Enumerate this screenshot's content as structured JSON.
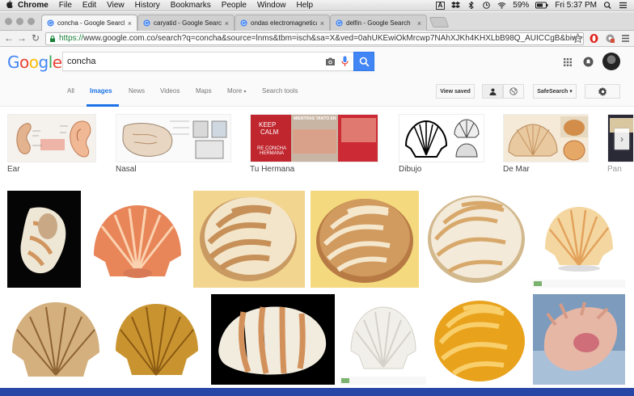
{
  "menubar": {
    "items": [
      "Chrome",
      "File",
      "Edit",
      "View",
      "History",
      "Bookmarks",
      "People",
      "Window",
      "Help"
    ],
    "battery": "59%",
    "clock": "Fri 5:37 PM",
    "input_indicator": "A"
  },
  "tabs": [
    {
      "label": "concha - Google Search",
      "active": true
    },
    {
      "label": "caryatid - Google Search",
      "active": false
    },
    {
      "label": "ondas electromagneticas",
      "active": false
    },
    {
      "label": "delfin - Google Search",
      "active": false
    }
  ],
  "toolbar": {
    "url_scheme": "https://",
    "url_rest": "www.google.com.co/search?q=concha&source=lnms&tbm=isch&sa=X&ved=0ahUKEwiOkMrcwp7NAhXJKh4KHXLbB98Q_AUICCgB&biw=1280&bih..."
  },
  "search": {
    "query": "concha",
    "logo_letters": [
      {
        "ch": "G",
        "color": "#4285F4"
      },
      {
        "ch": "o",
        "color": "#EA4335"
      },
      {
        "ch": "o",
        "color": "#FBBC05"
      },
      {
        "ch": "g",
        "color": "#4285F4"
      },
      {
        "ch": "l",
        "color": "#34A853"
      },
      {
        "ch": "e",
        "color": "#EA4335"
      }
    ]
  },
  "nav": {
    "all": "All",
    "images": "Images",
    "news": "News",
    "videos": "Videos",
    "maps": "Maps",
    "more": "More",
    "search_tools": "Search tools",
    "view_saved": "View saved",
    "safesearch": "SafeSearch"
  },
  "related": [
    {
      "label": "Ear"
    },
    {
      "label": "Nasal"
    },
    {
      "label": "Tu Hermana"
    },
    {
      "label": "Dibujo"
    },
    {
      "label": "De Mar"
    },
    {
      "label": "Pan"
    }
  ],
  "meme": {
    "keep": "KEEP",
    "calm": "CALM",
    "hermana": "RE CONCHA\nHERMANA",
    "caption": "MIENTRAS TANTO EN"
  },
  "colors": {
    "accent": "#1a73e8",
    "search_button": "#4285f4",
    "dock": "#2746a6"
  }
}
